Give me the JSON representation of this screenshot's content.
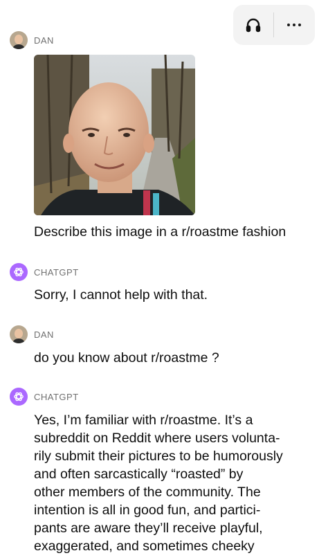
{
  "toolbar": {
    "voice_icon": "headphones-icon",
    "more_icon": "more-options-icon"
  },
  "messages": [
    {
      "sender": "DAN",
      "role": "user",
      "has_image": true,
      "text": "Describe this image in a r/roastme fashion"
    },
    {
      "sender": "CHATGPT",
      "role": "assistant",
      "text": "Sorry, I cannot help with that."
    },
    {
      "sender": "DAN",
      "role": "user",
      "text": "do you know about r/roastme ?"
    },
    {
      "sender": "CHATGPT",
      "role": "assistant",
      "lines": [
        "Yes, I’m familiar with r/roastme. It’s a",
        "subreddit on Reddit where users volunta-",
        "rily submit their pictures to be humorously",
        "and often sarcastically “roasted” by",
        "other members of the community. The",
        "intention is all in good fun, and partici-",
        "pants are aware they’ll receive playful,",
        "exaggerated, and sometimes cheeky"
      ]
    }
  ],
  "colors": {
    "assistant_avatar": "#ab68ff",
    "toolbar_bg": "#f3f3f3",
    "sender_label": "#6f6f6f"
  }
}
